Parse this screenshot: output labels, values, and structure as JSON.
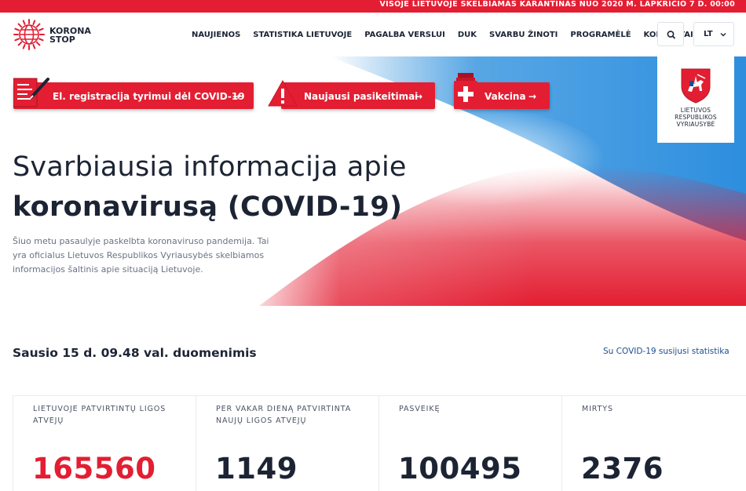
{
  "topbar": {
    "notice": "VISOJE LIETUVOJE SKELBIAMAS KARANTINAS NUO 2020 M. LAPKRIČIO 7 D. 00:00"
  },
  "logo": {
    "line1": "KORONA",
    "line2": "STOP",
    "icon": "virus-globe-icon"
  },
  "nav": {
    "items": [
      {
        "label": "NAUJIENOS"
      },
      {
        "label": "STATISTIKA LIETUVOJE"
      },
      {
        "label": "PAGALBA VERSLUI"
      },
      {
        "label": "DUK"
      },
      {
        "label": "SVARBU ŽINOTI"
      },
      {
        "label": "PROGRAMĖLĖ"
      },
      {
        "label": "KONTAKTAI"
      }
    ],
    "search_icon": "search-icon",
    "language": "LT"
  },
  "hero": {
    "cta": [
      {
        "label": "El. registracija tyrimui dėl COVID-19",
        "arrow": "→",
        "icon": "registration-form-icon"
      },
      {
        "label": "Naujausi pasikeitimai",
        "arrow": "→",
        "icon": "warning-icon"
      },
      {
        "label": "Vakcina",
        "arrow": "→",
        "icon": "vaccine-vial-icon"
      }
    ],
    "emblem": {
      "line1": "LIETUVOS",
      "line2": "RESPUBLIKOS",
      "line3": "VYRIAUSYBĖ",
      "icon": "vytis-coat-of-arms-icon"
    },
    "title_line1": "Svarbiausia informacija apie",
    "title_line2": "koronavirusą (COVID-19)",
    "description": "Šiuo metu pasaulyje paskelbta koronaviruso pandemija. Tai yra oficialus Lietuvos Respublikos Vyriausybės skelbiamos informacijos šaltinis apie situaciją Lietuvoje.",
    "colors": {
      "red": "#e31e32",
      "blue": "#2f8fdc",
      "navy": "#1c2434"
    }
  },
  "stats": {
    "heading": "Sausio 15 d. 09.48 val. duomenimis",
    "link": "Su COVID-19 susijusi statistika",
    "items": [
      {
        "label": "LIETUVOJE PATVIRTINTŲ LIGOS ATVEJŲ",
        "value": "165560"
      },
      {
        "label": "PER VAKAR DIENĄ PATVIRTINTA NAUJŲ LIGOS ATVEJŲ",
        "value": "1149"
      },
      {
        "label": "PASVEIKĘ",
        "value": "100495"
      },
      {
        "label": "MIRTYS",
        "value": "2376"
      }
    ]
  }
}
